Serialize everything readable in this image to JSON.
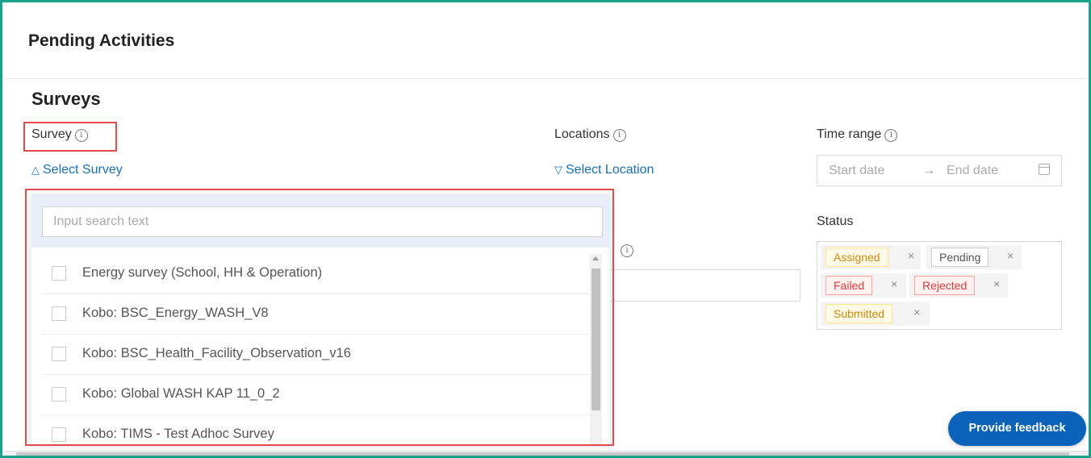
{
  "header": {
    "title": "Pending Activities"
  },
  "section": {
    "title": "Surveys"
  },
  "filters": {
    "survey": {
      "label": "Survey",
      "toggle_label": "Select Survey",
      "chevron": "chevron-up-icon"
    },
    "locations": {
      "label": "Locations",
      "toggle_label": "Select Location",
      "chevron": "chevron-down-icon"
    },
    "time_range": {
      "label": "Time range",
      "start_placeholder": "Start date",
      "arrow": "→",
      "end_placeholder": "End date",
      "icon": "calendar-icon"
    },
    "status": {
      "label": "Status",
      "tags": [
        {
          "label": "Assigned",
          "color": "#d4880f",
          "bg": "#fffbe6",
          "border": "#ffe58f"
        },
        {
          "label": "Pending",
          "color": "#555555",
          "bg": "#ffffff",
          "border": "#cccccc"
        },
        {
          "label": "Failed",
          "color": "#e03b3b",
          "bg": "#fff1f0",
          "border": "#ffa39e"
        },
        {
          "label": "Rejected",
          "color": "#e03b3b",
          "bg": "#fff1f0",
          "border": "#ffa39e"
        },
        {
          "label": "Submitted",
          "color": "#d4880f",
          "bg": "#fffbe6",
          "border": "#ffe58f"
        }
      ],
      "remove_glyph": "×"
    }
  },
  "info_glyph": "i",
  "survey_dropdown": {
    "search_placeholder": "Input search text",
    "items": [
      "Energy survey (School, HH & Operation)",
      "Kobo: BSC_Energy_WASH_V8",
      "Kobo: BSC_Health_Facility_Observation_v16",
      "Kobo: Global WASH KAP 11_0_2",
      "Kobo: TIMS - Test Adhoc Survey"
    ]
  },
  "feedback_button": {
    "label": "Provide feedback"
  },
  "colors": {
    "accent": "#1a6fb5",
    "frame": "#1aa38a",
    "highlight": "#e14b4b",
    "feedback_bg": "#0a63b8"
  }
}
